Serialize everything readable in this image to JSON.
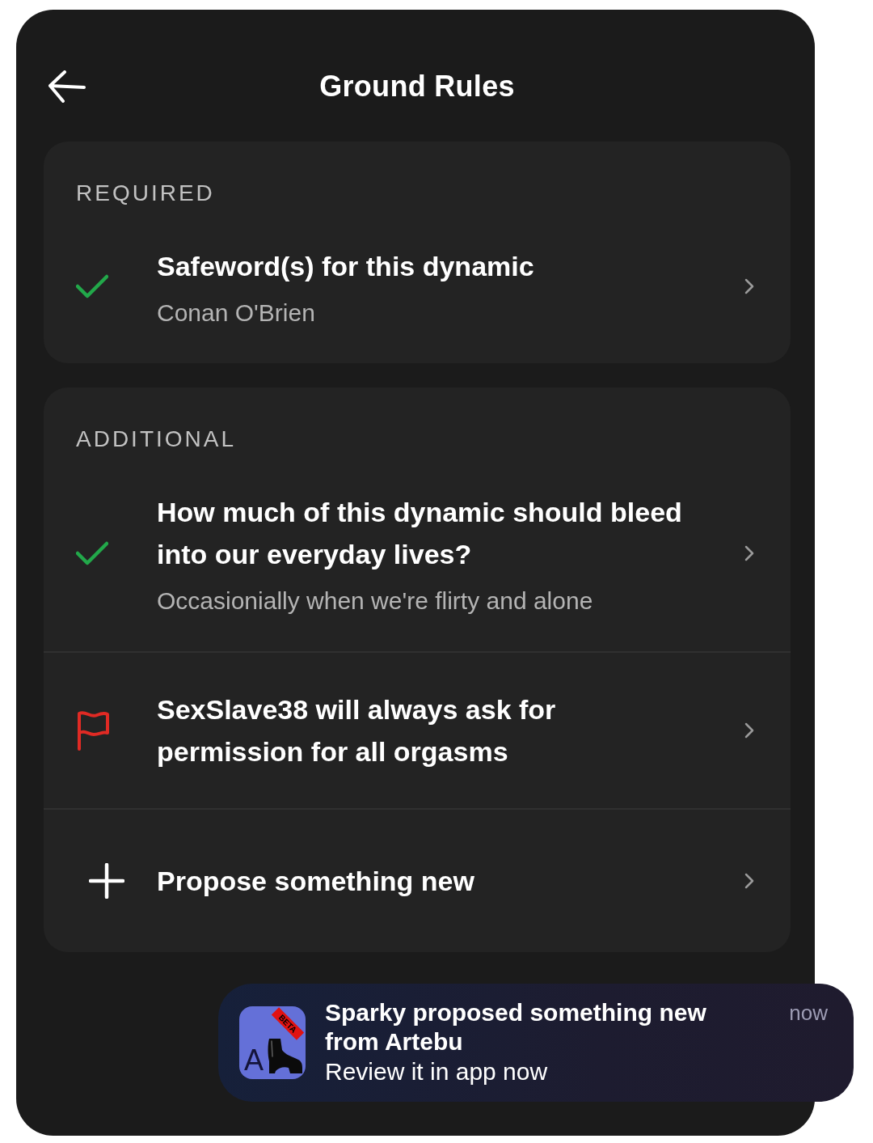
{
  "header": {
    "title": "Ground Rules"
  },
  "sections": [
    {
      "heading": "REQUIRED",
      "items": [
        {
          "kind": "rule",
          "flagged": false,
          "title": "Safeword(s) for this dynamic",
          "answer": "Conan O'Brien"
        }
      ]
    },
    {
      "heading": "ADDITIONAL",
      "items": [
        {
          "kind": "rule",
          "flagged": false,
          "title": "How much of this dynamic should bleed into our everyday lives?",
          "answer": "Occasionially when we're flirty and alone"
        },
        {
          "kind": "rule",
          "flagged": true,
          "title": "SexSlave38 will always ask for permission for all orgasms"
        },
        {
          "kind": "add",
          "title": "Propose something new"
        }
      ]
    }
  ],
  "notification": {
    "app_icon": {
      "letter": "A",
      "ribbon": "BETA"
    },
    "title": "Sparky proposed something new from Artebu",
    "body": "Review it in app now",
    "time": "now"
  }
}
